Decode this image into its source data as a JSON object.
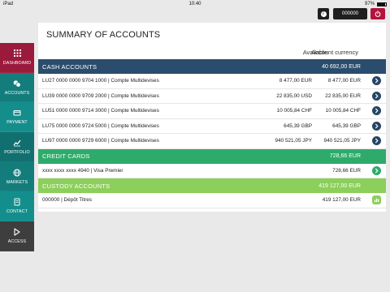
{
  "status_bar": {
    "device": "iPad",
    "time": "10:40",
    "battery": "97%"
  },
  "topbar": {
    "account_number": "000000"
  },
  "sidebar": {
    "items": [
      {
        "label": "DASHBOARD",
        "icon": "grid-icon",
        "bg": "#9b1a3c"
      },
      {
        "label": "ACCOUNTS",
        "icon": "coins-icon",
        "bg": "#137d7c"
      },
      {
        "label": "PAYMENT",
        "icon": "card-icon",
        "bg": "#148e8d"
      },
      {
        "label": "PORTFOLIO",
        "icon": "chart-icon",
        "bg": "#11706f"
      },
      {
        "label": "MARKETS",
        "icon": "globe-icon",
        "bg": "#137d7c"
      },
      {
        "label": "CONTACT",
        "icon": "contact-icon",
        "bg": "#148e8d"
      },
      {
        "label": "ACCESS",
        "icon": "access-icon",
        "bg": "#3e3e3e"
      }
    ]
  },
  "main": {
    "title": "SUMMARY OF ACCOUNTS",
    "columns": {
      "available": "Available",
      "currency": "Account currency"
    },
    "sections": [
      {
        "label": "CASH ACCOUNTS",
        "total": "40 692,00 EUR",
        "color": "#2b4d6d",
        "btn_color": "#274565",
        "btn_icon": "chevron-right-icon",
        "rows": [
          {
            "name": "LU27 0000 0000 9704 1000 | Compte Multidevises",
            "available": "8 477,00 EUR",
            "currency": "8 477,00 EUR"
          },
          {
            "name": "LU39 0000 0000 9709 2000 | Compte Multidevises",
            "available": "22 835,00 USD",
            "currency": "22 835,00 EUR"
          },
          {
            "name": "LU51 0000 0000 9714 3000 | Compte Multidevises",
            "available": "10 005,84 CHF",
            "currency": "10 005,84 CHF"
          },
          {
            "name": "LU75 0000 0000 9724 5000 | Compte Multidevises",
            "available": "645,39 GBP",
            "currency": "645,39 GBP"
          },
          {
            "name": "LU97 0000 0000 9729 6000 | Compte Multidevises",
            "available": "940 521,05 JPY",
            "currency": "940 521,05 JPY"
          }
        ]
      },
      {
        "label": "CREDIT CARDS",
        "total": "728,66 EUR",
        "color": "#2eab6b",
        "btn_color": "#2eab6b",
        "btn_icon": "chevron-right-icon",
        "rows": [
          {
            "name": "xxxx xxxx xxxx 4940 | Visa Premier",
            "available": "",
            "currency": "728,66 EUR"
          }
        ]
      },
      {
        "label": "CUSTODY ACCOUNTS",
        "total": "419 127,00 EUR",
        "color": "#8ccf5b",
        "btn_color": "#8ccf5b",
        "btn_icon": "bar-chart-icon",
        "rows": [
          {
            "name": "000000 | Dépôt Titres",
            "available": "",
            "currency": "419 127,00 EUR"
          }
        ]
      }
    ]
  }
}
